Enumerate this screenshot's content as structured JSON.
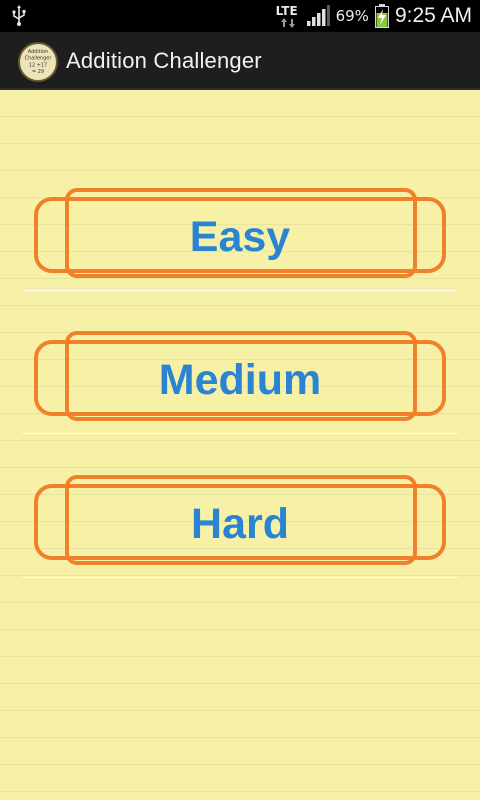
{
  "status_bar": {
    "network": "LTE",
    "battery": "69%",
    "time": "9:25 AM"
  },
  "action_bar": {
    "title": "Addition Challenger",
    "icon_lines": [
      "Addition",
      "Challenger",
      "12 +17",
      "= 29"
    ]
  },
  "difficulty": {
    "easy": "Easy",
    "medium": "Medium",
    "hard": "Hard"
  },
  "colors": {
    "paper": "#f6f1a6",
    "outline": "#f0812a",
    "label": "#2a84d2"
  }
}
